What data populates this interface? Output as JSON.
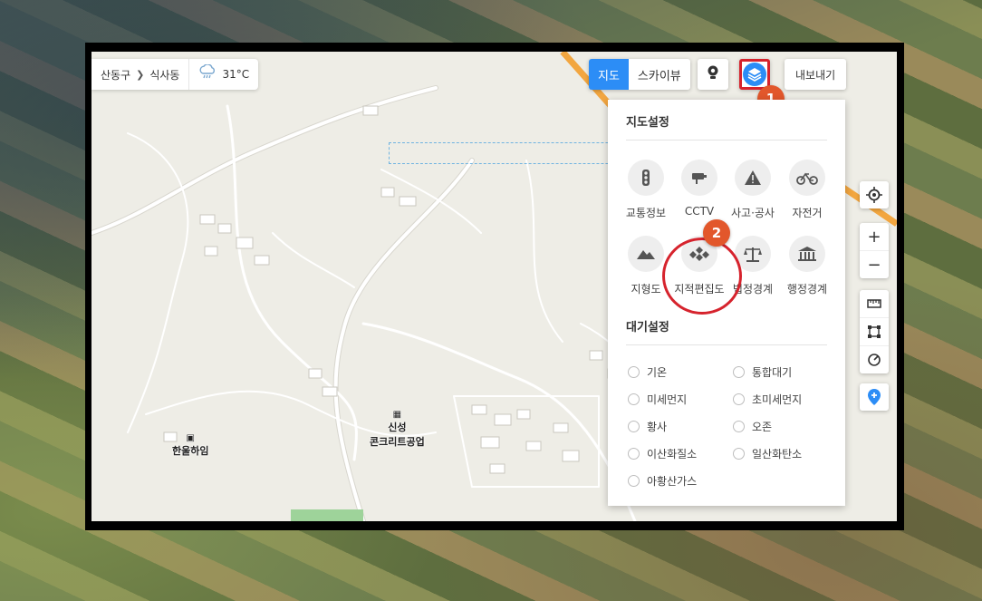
{
  "breadcrumb": {
    "district": "산동구",
    "dong": "식사동",
    "temperature": "31°C"
  },
  "map_type": {
    "map_label": "지도",
    "skyview_label": "스카이뷰",
    "selected": "지도"
  },
  "toolbar": {
    "export_label": "내보내기"
  },
  "badges": {
    "step1": "1",
    "step2": "2"
  },
  "panel": {
    "map_settings_title": "지도설정",
    "layers": [
      {
        "label": "교통정보",
        "icon": "traffic-light-icon"
      },
      {
        "label": "CCTV",
        "icon": "cctv-icon"
      },
      {
        "label": "사고·공사",
        "icon": "warning-icon"
      },
      {
        "label": "자전거",
        "icon": "bicycle-icon"
      },
      {
        "label": "지형도",
        "icon": "mountain-icon"
      },
      {
        "label": "지적편집도",
        "icon": "cadastral-icon"
      },
      {
        "label": "법정경계",
        "icon": "scale-icon"
      },
      {
        "label": "행정경계",
        "icon": "government-building-icon"
      }
    ],
    "air_settings_title": "대기설정",
    "air_options": [
      {
        "label": "기온"
      },
      {
        "label": "통합대기"
      },
      {
        "label": "미세먼지"
      },
      {
        "label": "초미세먼지"
      },
      {
        "label": "황사"
      },
      {
        "label": "오존"
      },
      {
        "label": "이산화질소"
      },
      {
        "label": "일산화탄소"
      },
      {
        "label": "아황산가스"
      }
    ]
  },
  "poi": {
    "hanul": "한울하임",
    "factory_line1": "신성",
    "factory_line2": "콘크리트공업"
  },
  "colors": {
    "accent": "#2c8df6",
    "highlight_ring": "#d6232d",
    "badge": "#e2572b"
  }
}
